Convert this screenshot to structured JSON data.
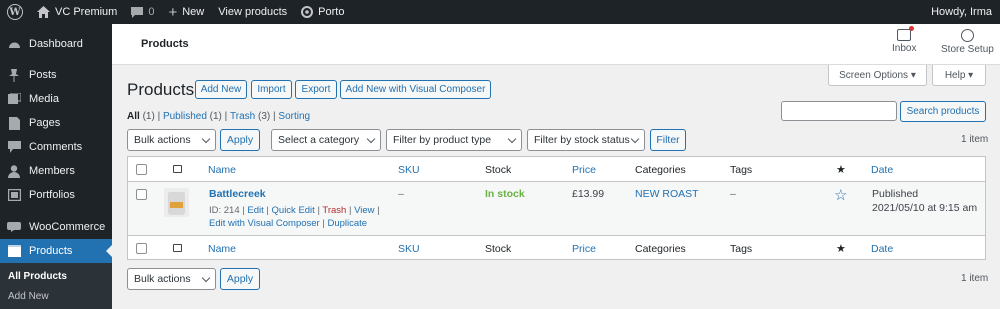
{
  "adminbar": {
    "site_name": "VC Premium",
    "comments_count": "0",
    "new_label": "New",
    "view_products": "View products",
    "porto": "Porto",
    "howdy": "Howdy, Irma"
  },
  "sidebar": {
    "items": [
      {
        "label": "Dashboard",
        "icon": "dashboard-icon"
      },
      {
        "label": "Posts",
        "icon": "pin-icon"
      },
      {
        "label": "Media",
        "icon": "media-icon"
      },
      {
        "label": "Pages",
        "icon": "page-icon"
      },
      {
        "label": "Comments",
        "icon": "comment-icon"
      },
      {
        "label": "Members",
        "icon": "members-icon"
      },
      {
        "label": "Portfolios",
        "icon": "portfolio-icon"
      },
      {
        "label": "WooCommerce",
        "icon": "woo-icon"
      },
      {
        "label": "Products",
        "icon": "products-icon"
      }
    ],
    "submenu": [
      "All Products",
      "Add New"
    ]
  },
  "topbar": {
    "title": "Products",
    "inbox": "Inbox",
    "store_setup": "Store Setup"
  },
  "screen_options": "Screen Options ▾",
  "help": "Help ▾",
  "page": {
    "title": "Products",
    "buttons": [
      "Add New",
      "Import",
      "Export",
      "Add New with Visual Composer"
    ]
  },
  "views": {
    "all": "All",
    "all_count": "(1)",
    "published": "Published",
    "published_count": "(1)",
    "trash": "Trash",
    "trash_count": "(3)",
    "sorting": "Sorting",
    "sep": " | "
  },
  "search": {
    "button": "Search products",
    "value": ""
  },
  "filters": {
    "bulk": "Bulk actions",
    "apply": "Apply",
    "category": "Select a category",
    "type": "Filter by product type",
    "stock": "Filter by stock status",
    "filter": "Filter"
  },
  "item_count": "1 item",
  "columns": {
    "name": "Name",
    "sku": "SKU",
    "stock": "Stock",
    "price": "Price",
    "categories": "Categories",
    "tags": "Tags",
    "date": "Date"
  },
  "product": {
    "name": "Battlecreek",
    "sku": "–",
    "stock": "In stock",
    "price": "£13.99",
    "category": "NEW ROAST",
    "tags": "–",
    "status": "Published",
    "date": "2021/05/10 at 9:15 am",
    "id_text": "ID: 214",
    "actions": {
      "edit": "Edit",
      "quick_edit": "Quick Edit",
      "trash": "Trash",
      "view": "View",
      "edit_vc": "Edit with Visual Composer",
      "duplicate": "Duplicate"
    }
  },
  "colors": {
    "admin_bg": "#1d2327",
    "accent": "#2271b1",
    "in_stock": "#6ab344",
    "trash": "#b32d2e"
  }
}
